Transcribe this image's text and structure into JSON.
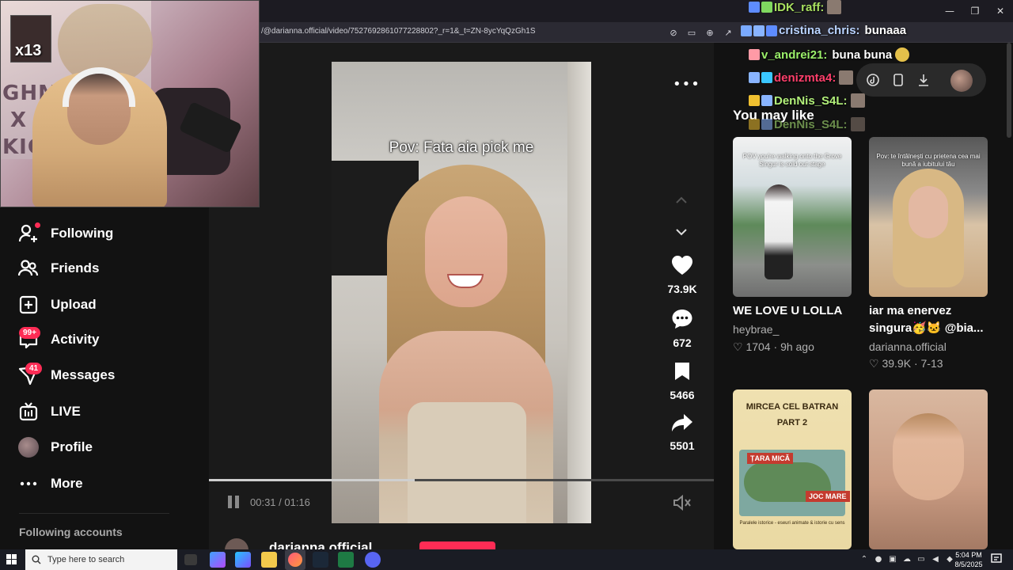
{
  "browser": {
    "url": "/@darianna.official/video/7527692861077228802?_r=1&_t=ZN-8ycYqQzGh1S",
    "window_buttons": [
      "—",
      "❐",
      "✕"
    ]
  },
  "webcam": {
    "overlay_text": "x13",
    "poster_text": "GHMA\n X\nKICK"
  },
  "sidebar": {
    "items": [
      {
        "label": "Following",
        "icon": "following-icon"
      },
      {
        "label": "Friends",
        "icon": "friends-icon"
      },
      {
        "label": "Upload",
        "icon": "upload-icon"
      },
      {
        "label": "Activity",
        "icon": "activity-icon",
        "badge": "99+"
      },
      {
        "label": "Messages",
        "icon": "messages-icon",
        "badge": "41"
      },
      {
        "label": "LIVE",
        "icon": "live-icon"
      },
      {
        "label": "Profile",
        "icon": "profile-avatar"
      },
      {
        "label": "More",
        "icon": "more-icon"
      }
    ],
    "following_accounts": "Following accounts"
  },
  "video": {
    "caption": "Pov: Fata aia pick me",
    "current_time": "00:31",
    "duration": "01:16",
    "time_display": "00:31 / 01:16",
    "progress_fraction": 0.408,
    "likes": "73.9K",
    "comments": "672",
    "saves": "5466",
    "shares": "5501",
    "author": "darianna.official"
  },
  "recommendations": {
    "title": "You may like",
    "cards": [
      {
        "title": "WE LOVE U LOLLA",
        "author": "heybrae_",
        "likes": "1704",
        "age": "9h ago",
        "thumb_caption": "POV you're walking onto the Grove Singur is sold out stage"
      },
      {
        "title": "iar ma enervez singura🥳🐱 @bia...",
        "title_line1": "iar ma enervez",
        "title_line2": "singura🥳🐱 @bia...",
        "author": "darianna.official",
        "likes": "39.9K",
        "age": "7-13",
        "thumb_caption": "Pov: te întâlnești cu prietena cea mai bună a iubitului tău"
      },
      {
        "thumb_title": "MIRCEA CEL BATRAN",
        "thumb_part": "PART 2",
        "map_label_1": "ȚARA MICĂ",
        "map_label_2": "JOC MARE",
        "footer": "Paralele istorice - eseuri animate & istorie cu sens"
      },
      {}
    ]
  },
  "chat": [
    {
      "user": "IDK_raff:",
      "message": "",
      "color": "#a8e05f"
    },
    {
      "user": "cristina_chris:",
      "message": "bunaaa",
      "color": "#b9d3ff"
    },
    {
      "user": "v_andrei21:",
      "message": "buna buna",
      "color": "#9bf06a"
    },
    {
      "user": "denizmta4:",
      "message": "",
      "color": "#ff3f6b"
    },
    {
      "user": "DenNis_S4L:",
      "message": "",
      "color": "#b2f07a"
    },
    {
      "user": "DenNis_S4L:",
      "message": "",
      "color": "#b2f07a"
    }
  ],
  "taskbar": {
    "search_placeholder": "Type here to search",
    "time": "5:04 PM",
    "date": "8/5/2025"
  },
  "colors": {
    "accent": "#fe2c55",
    "background": "#121212"
  }
}
